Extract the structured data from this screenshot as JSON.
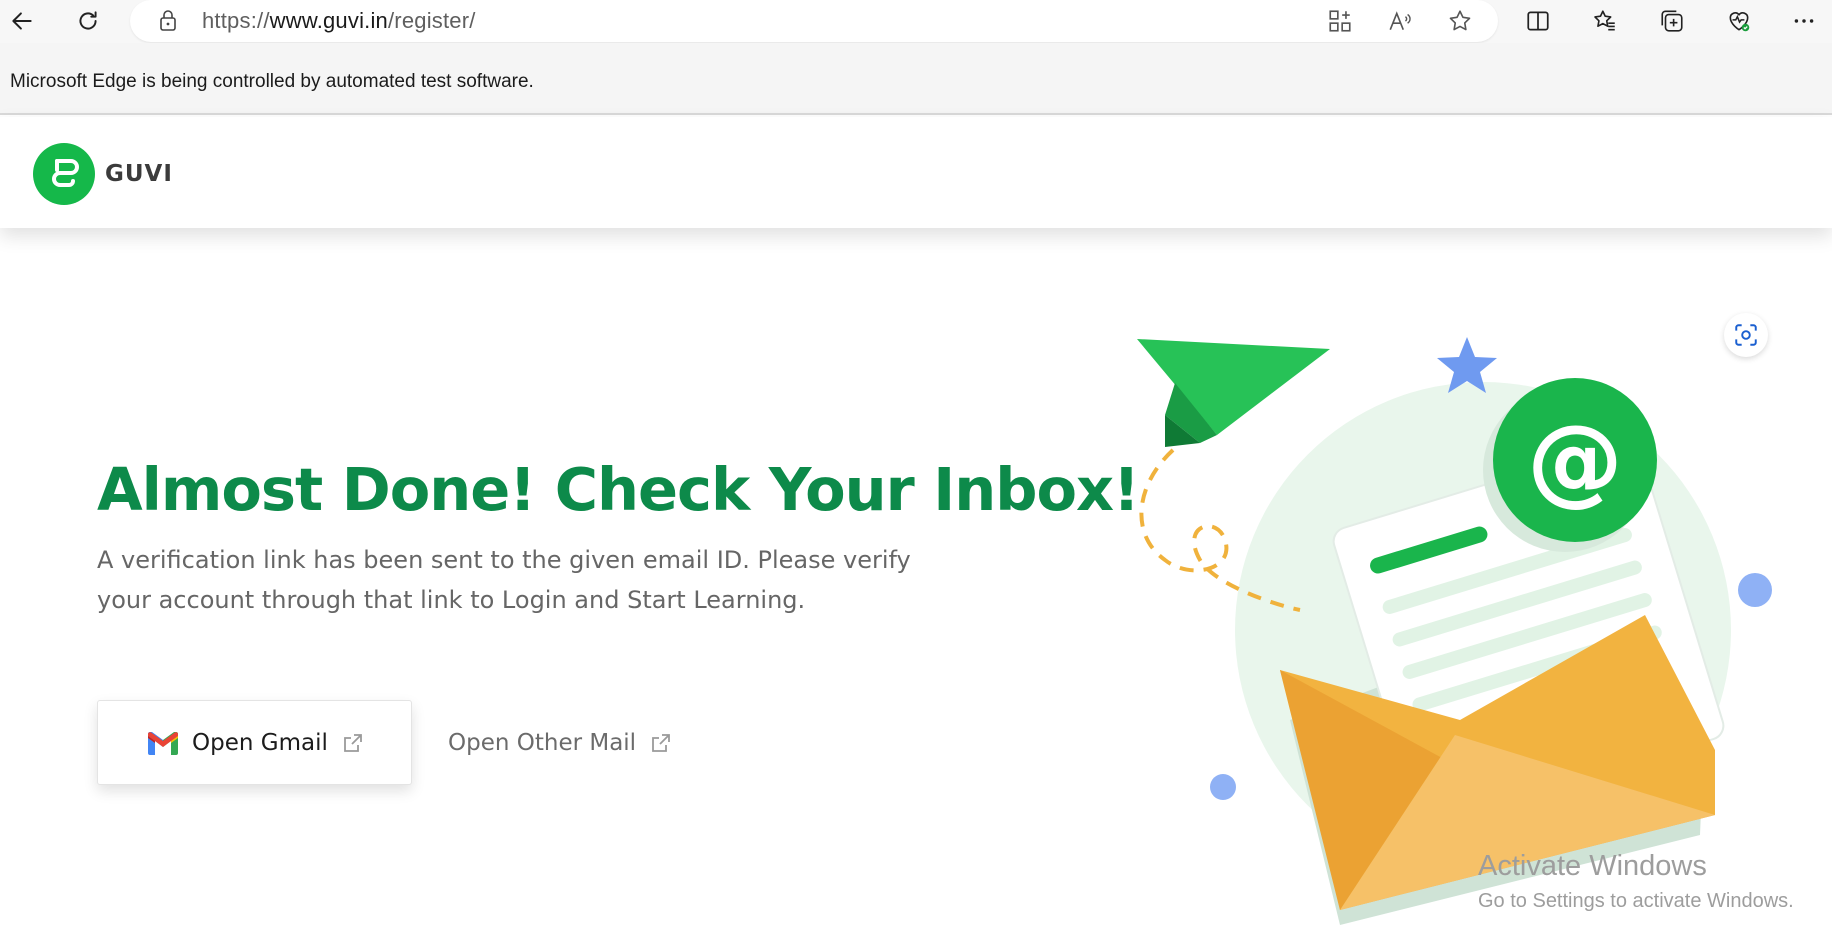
{
  "browser": {
    "url_prefix": "https://",
    "url_host": "www.guvi.in",
    "url_path": "/register/",
    "icons": [
      "back-arrow-icon",
      "refresh-icon",
      "lock-icon",
      "app-available-icon",
      "read-aloud-icon",
      "favorite-star-icon",
      "split-screen-icon",
      "favorites-icon",
      "collections-icon",
      "browser-essentials-icon",
      "more-icon"
    ]
  },
  "infobar": {
    "message": "Microsoft Edge is being controlled by automated test software."
  },
  "header": {
    "logo_text": "GUVI",
    "brand_color": "#15b84a"
  },
  "main": {
    "title": "Almost Done! Check Your Inbox!",
    "description": "A verification link has been sent to the given email ID. Please verify your account through that link to Login and Start Learning.",
    "gmail_button_label": "Open Gmail",
    "other_mail_label": "Open Other Mail",
    "title_color": "#0d8a4a"
  },
  "watermark": {
    "title": "Activate Windows",
    "subtitle": "Go to Settings to activate Windows."
  }
}
